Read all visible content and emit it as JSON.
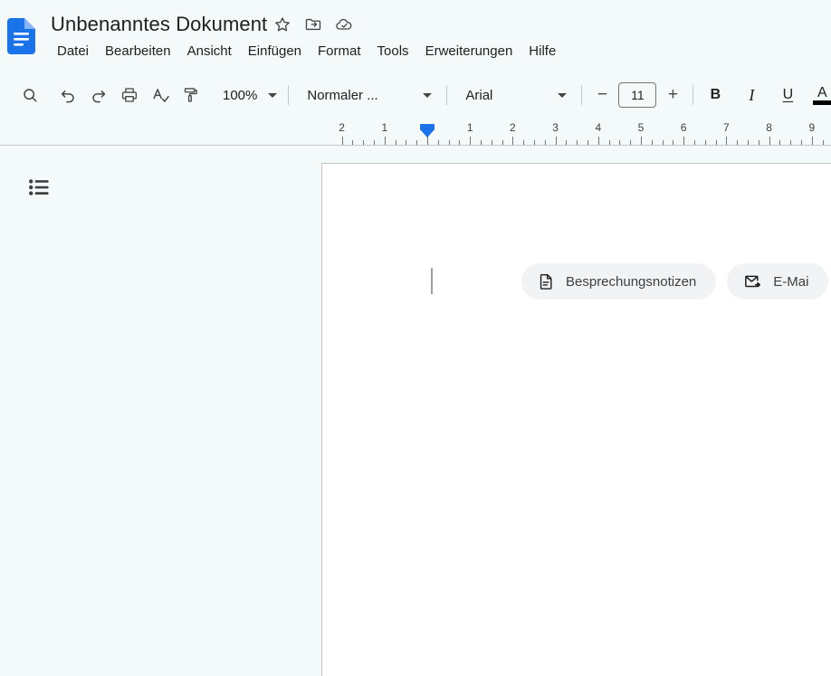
{
  "app": {
    "name": "Google Docs",
    "logo_icon": "google-docs-logo",
    "accent_color": "#1a73e8",
    "background_color": "#f4f9fa",
    "page_color": "#ffffff"
  },
  "header": {
    "doc_title": "Unbenanntes Dokument",
    "title_actions": [
      {
        "name": "star-icon",
        "label": "Markieren"
      },
      {
        "name": "move-to-folder-icon",
        "label": "Verschieben"
      },
      {
        "name": "cloud-done-icon",
        "label": "In Drive gespeichert"
      }
    ],
    "menu": [
      {
        "label": "Datei"
      },
      {
        "label": "Bearbeiten"
      },
      {
        "label": "Ansicht"
      },
      {
        "label": "Einfügen"
      },
      {
        "label": "Format"
      },
      {
        "label": "Tools"
      },
      {
        "label": "Erweiterungen"
      },
      {
        "label": "Hilfe"
      }
    ]
  },
  "toolbar": {
    "buttons": [
      {
        "name": "search-icon",
        "label": "Suchen"
      },
      {
        "name": "undo-icon",
        "label": "Rückgängig"
      },
      {
        "name": "redo-icon",
        "label": "Wiederholen"
      },
      {
        "name": "print-icon",
        "label": "Drucken"
      },
      {
        "name": "spellcheck-icon",
        "label": "Rechtschreibprüfung"
      },
      {
        "name": "paint-format-icon",
        "label": "Format übertragen"
      }
    ],
    "zoom": {
      "value": "100%"
    },
    "paragraph_style": {
      "value": "Normaler ..."
    },
    "font": {
      "value": "Arial"
    },
    "font_size": {
      "value": "11",
      "decrease_label": "−",
      "increase_label": "+"
    },
    "format_buttons": [
      {
        "name": "bold-button",
        "label": "B"
      },
      {
        "name": "italic-button",
        "label": "I"
      },
      {
        "name": "underline-button",
        "label": "U"
      },
      {
        "name": "text-color-button",
        "label": "A",
        "color": "#000000"
      }
    ]
  },
  "ruler": {
    "numbers": [
      "2",
      "1",
      "1",
      "2",
      "3",
      "4",
      "5",
      "6",
      "7",
      "8",
      "9"
    ],
    "unit": "inch",
    "indent_marker_label": "Einzug"
  },
  "sidebar": {
    "outline_button": {
      "name": "show-outline-icon",
      "label": "Dokumentgliederung einblenden"
    }
  },
  "document": {
    "chips": [
      {
        "icon": "meeting-notes-icon",
        "label": "Besprechungsnotizen"
      },
      {
        "icon": "email-draft-icon",
        "label": "E-Mai"
      }
    ]
  }
}
